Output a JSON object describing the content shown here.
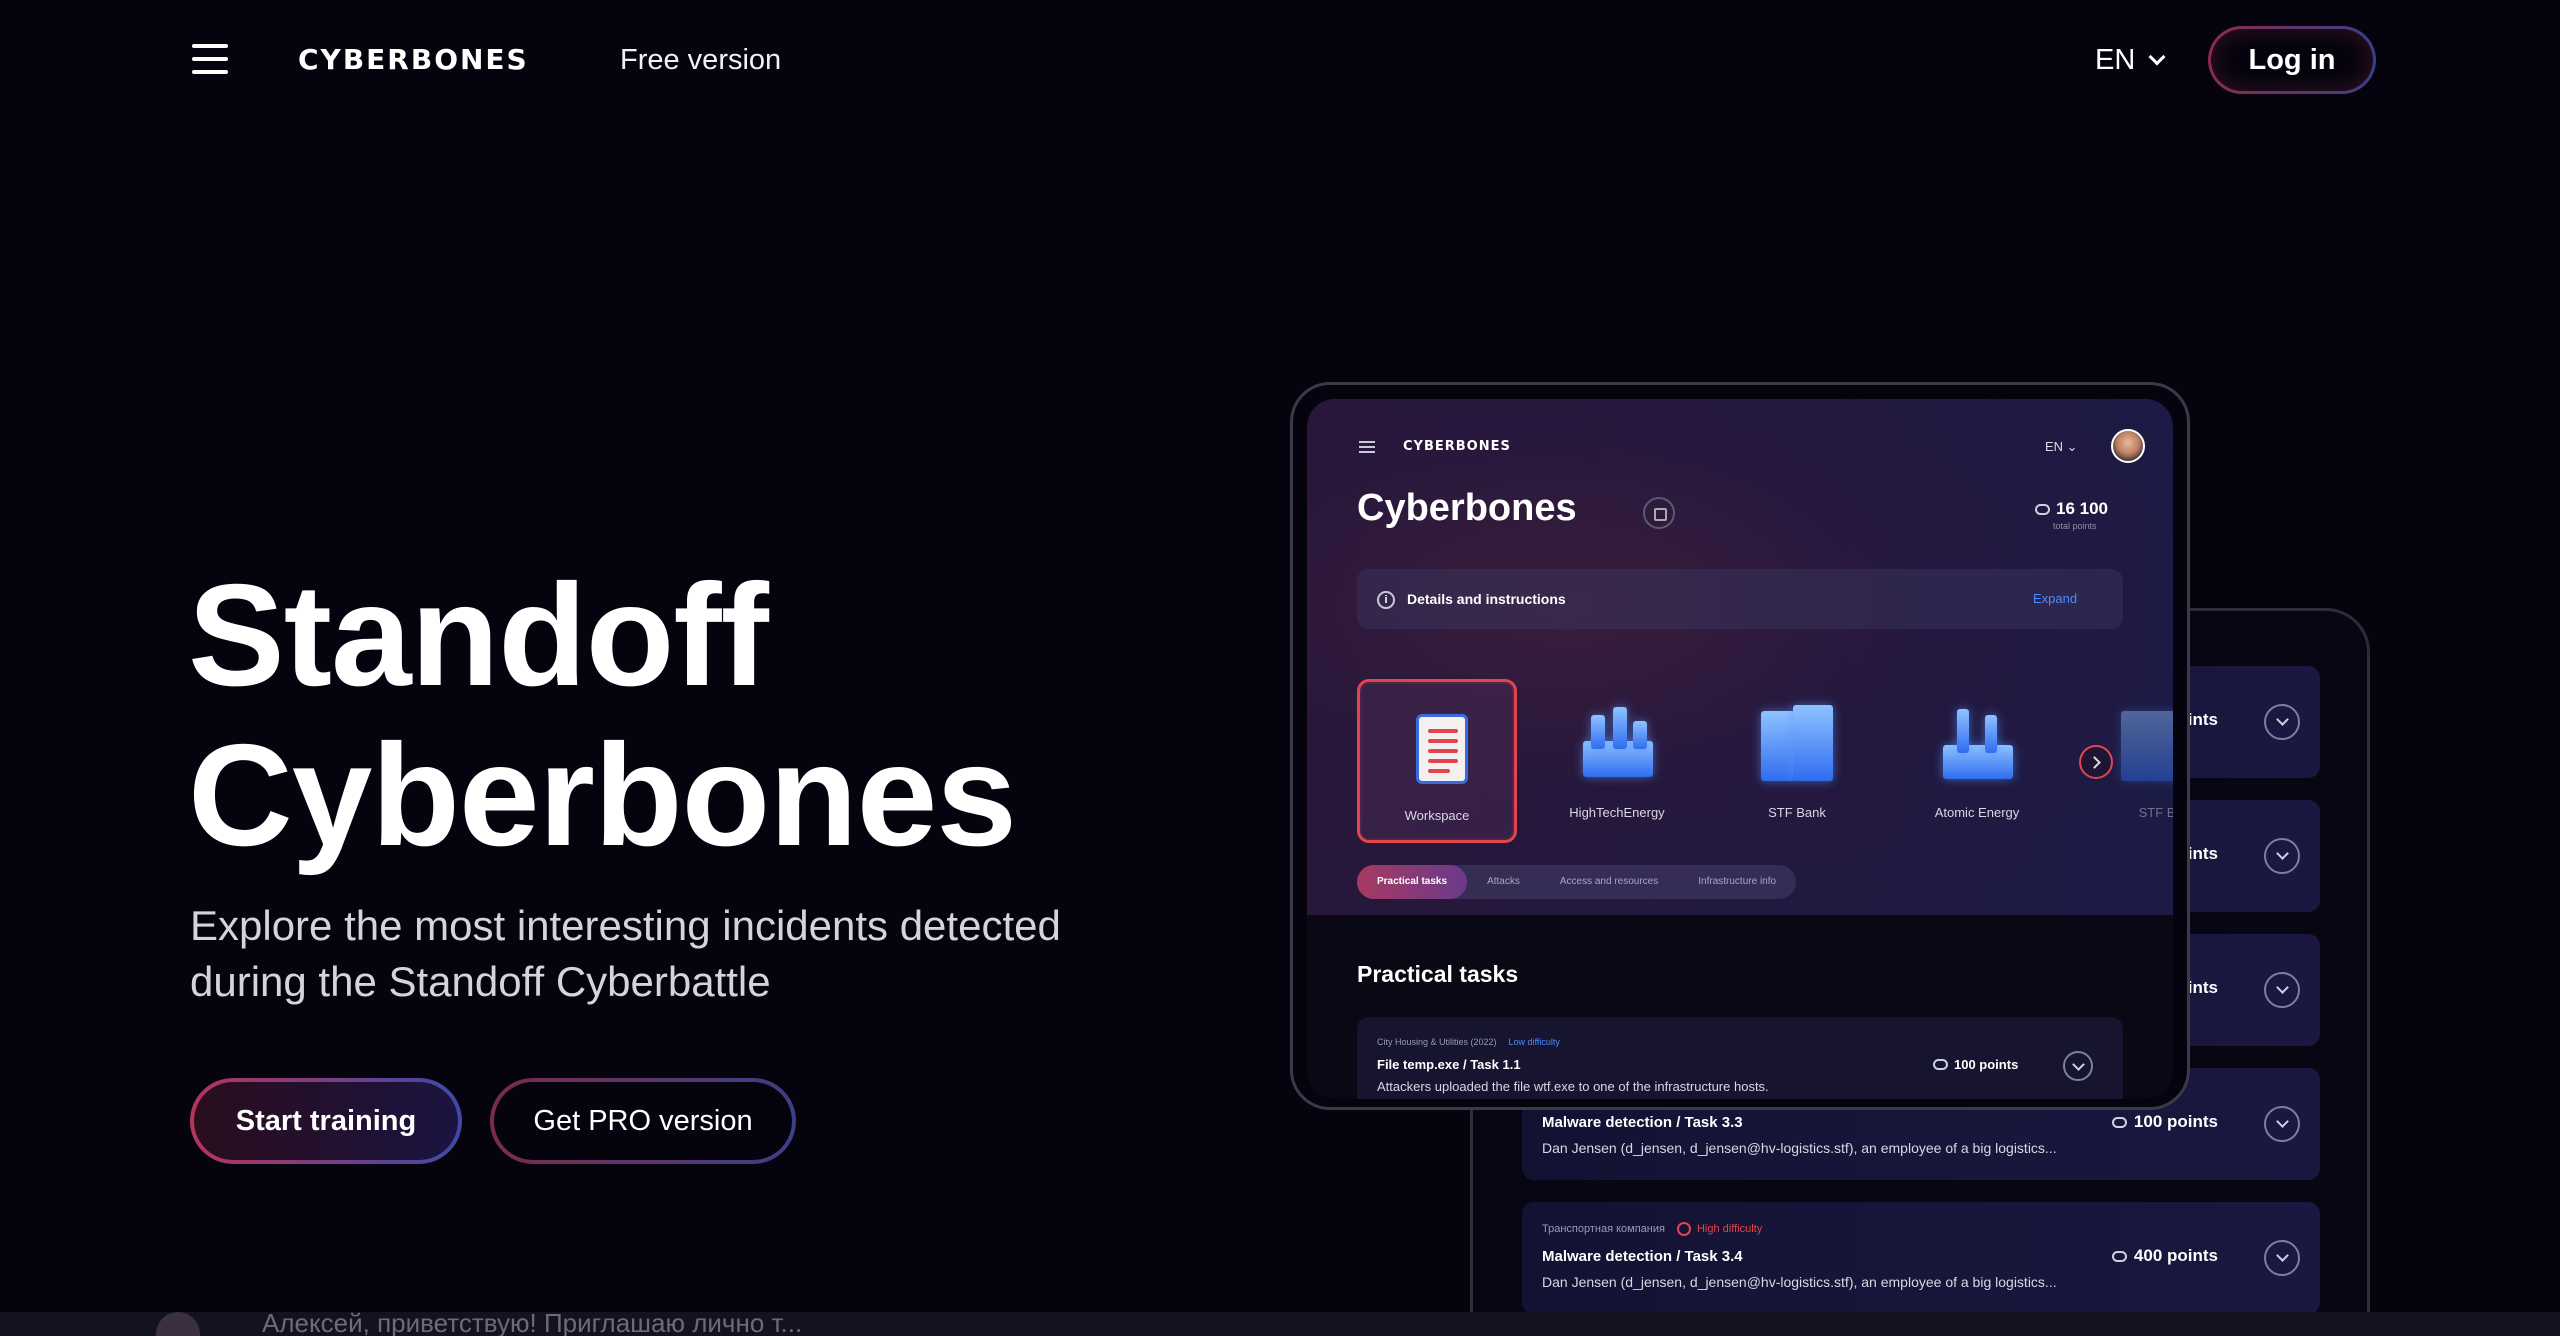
{
  "header": {
    "logo": "CYBERBONES",
    "free_version": "Free version",
    "language": "EN",
    "login_label": "Log in"
  },
  "hero": {
    "title_line1": "Standoff",
    "title_line2": "Cyberbones",
    "subtitle": "Explore the most interesting incidents detected during the Standoff Cyberbattle",
    "start_button": "Start training",
    "pro_button": "Get PRO version"
  },
  "app_preview": {
    "logo": "CYBERBONES",
    "language": "EN",
    "title": "Cyberbones",
    "points": "16 100",
    "points_label": "total points",
    "details_label": "Details and instructions",
    "expand_label": "Expand",
    "categories": [
      {
        "label": "Workspace",
        "icon": "document-icon"
      },
      {
        "label": "HighTechEnergy",
        "icon": "factory-icon"
      },
      {
        "label": "STF Bank",
        "icon": "bank-icon"
      },
      {
        "label": "Atomic Energy",
        "icon": "power-plant-icon"
      },
      {
        "label": "STF B",
        "icon": "bank-icon"
      }
    ],
    "tabs": [
      {
        "label": "Practical tasks",
        "active": true
      },
      {
        "label": "Attacks",
        "active": false
      },
      {
        "label": "Access and resources",
        "active": false
      },
      {
        "label": "Infrastructure info",
        "active": false
      }
    ],
    "section_title": "Practical tasks",
    "task": {
      "category": "City Housing & Utilities (2022)",
      "difficulty": "Low difficulty",
      "title": "File temp.exe / Task 1.1",
      "description": "Attackers uploaded the file wtf.exe to one of the infrastructure hosts.",
      "points": "100 points"
    }
  },
  "back_preview": {
    "rows": [
      {
        "category": "",
        "difficulty": "",
        "title": "",
        "description": "",
        "points": "ints"
      },
      {
        "category": "",
        "difficulty": "",
        "title": "",
        "description": "",
        "points": "ints"
      },
      {
        "category": "",
        "difficulty": "",
        "title": "",
        "description": "",
        "points": "ints"
      },
      {
        "category": "",
        "difficulty": "",
        "title": "Malware detection / Task 3.3",
        "description": "Dan Jensen (d_jensen, d_jensen@hv-logistics.stf), an employee of a big logistics...",
        "points": "100 points"
      },
      {
        "category": "Транспортная компания",
        "difficulty": "High difficulty",
        "title": "Malware detection / Task 3.4",
        "description": "Dan Jensen (d_jensen, d_jensen@hv-logistics.stf), an employee of a big logistics...",
        "points": "400 points"
      }
    ]
  },
  "notification": {
    "text": "Алексей, приветствую! Приглашаю лично т..."
  },
  "colors": {
    "background": "#05040e",
    "accent_red": "#e2454d",
    "accent_blue": "#4c8cff"
  }
}
